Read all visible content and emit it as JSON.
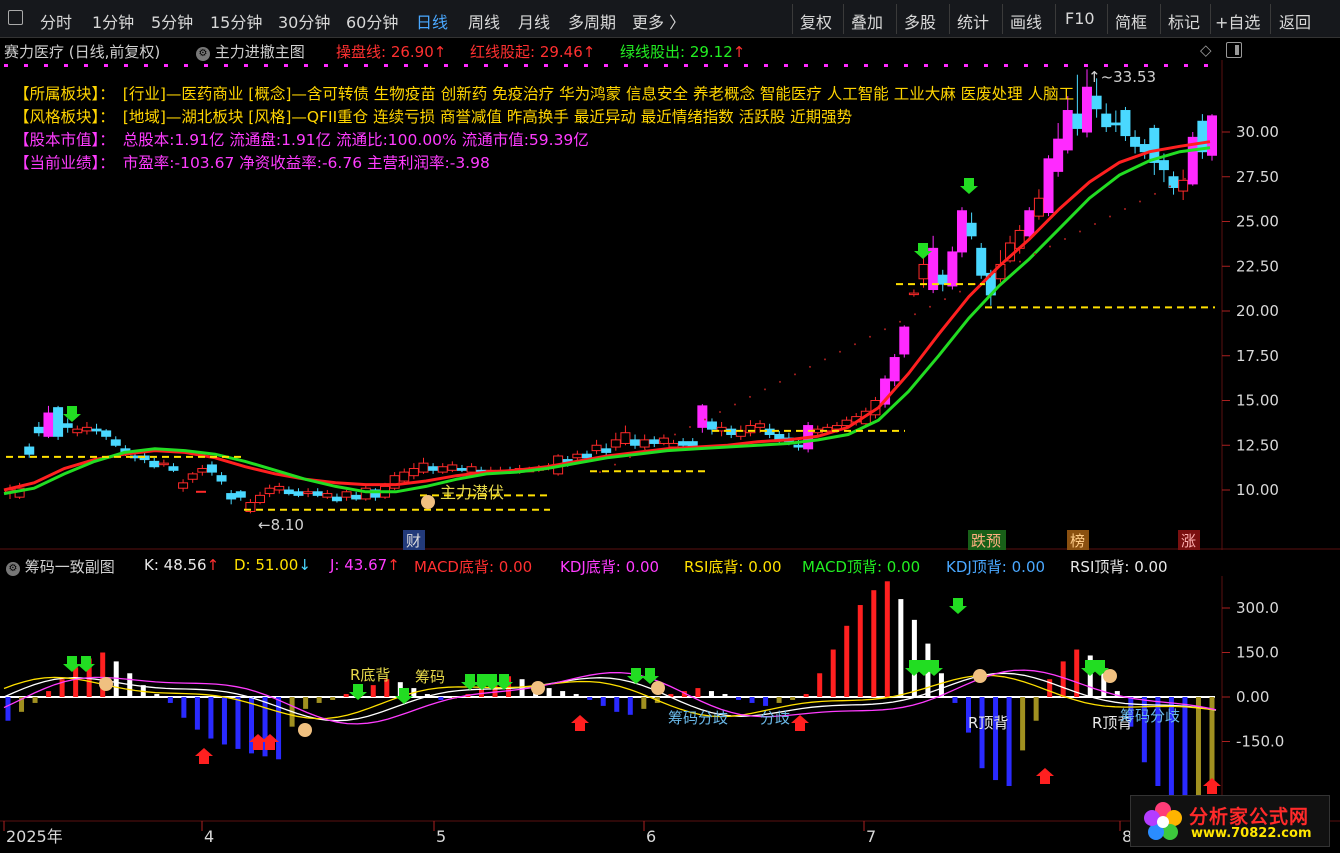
{
  "toolbar": {
    "left": [
      "分时",
      "1分钟",
      "5分钟",
      "15分钟",
      "30分钟",
      "60分钟",
      "日线",
      "周线",
      "月线",
      "多周期",
      "更多 〉"
    ],
    "active": "日线",
    "right": [
      "复权",
      "叠加",
      "多股",
      "统计",
      "画线",
      "F10",
      "简框",
      "标记",
      "+自选",
      "返回"
    ]
  },
  "main_header": {
    "stock": "赛力医疗 (日线,前复权)",
    "indicator": "主力进撤主图",
    "cpx_label": "操盘线: 26.90",
    "red_label": "红线股起: 29.46",
    "green_label": "绿线股出: 29.12",
    "arrow": "↑"
  },
  "info_lines": [
    {
      "tag": "【所属板块】：",
      "text": "[行业]—医药商业 [概念]—含可转债 生物疫苗 创新药 免疫治疗 华为鸿蒙 信息安全 养老概念 智能医疗 人工智能 工业大麻 医废处理 人脑工",
      "tag_color": "#ffd500",
      "text_color": "#ffd500"
    },
    {
      "tag": "【风格板块】：",
      "text": "[地域]—湖北板块 [风格]—QFII重仓 连续亏损 商誉减值 昨高换手 最近异动 最近情绪指数 活跃股 近期强势",
      "tag_color": "#ffd500",
      "text_color": "#ffd500"
    },
    {
      "tag": "【股本市值】：",
      "text": "总股本:1.91亿 流通盘:1.91亿 流通比:100.00% 流通市值:59.39亿",
      "tag_color": "#ff3cff",
      "text_color": "#ff3cff"
    },
    {
      "tag": "【当前业绩】：",
      "text": "市盈率:-103.67 净资收益率:-6.76 主营利润率:-3.98",
      "tag_color": "#ff3cff",
      "text_color": "#ff3cff"
    }
  ],
  "sub_header": {
    "indicator": "筹码一致副图",
    "k": "K: 48.56",
    "d": "D: 51.00",
    "j": "J: 43.67",
    "macd_bot": "MACD底背: 0.00",
    "kdj_bot": "KDJ底背: 0.00",
    "rsi_bot": "RSI底背: 0.00",
    "macd_top": "MACD顶背: 0.00",
    "kdj_top": "KDJ顶背: 0.00",
    "rsi_top": "RSI顶背: 0.00"
  },
  "chart_data": [
    {
      "type": "candlestick",
      "title": "主力进撤主图",
      "ylim": [
        8.0,
        34.5
      ],
      "yticks": [
        "30.00",
        "27.50",
        "25.00",
        "22.50",
        "20.00",
        "17.50",
        "15.00",
        "12.50",
        "10.00"
      ],
      "ytick_values": [
        30.0,
        27.5,
        25.0,
        22.5,
        20.0,
        17.5,
        15.0,
        12.5,
        10.0
      ],
      "x_labels": [
        "2025年",
        "4",
        "5",
        "6",
        "7",
        "8"
      ],
      "series": [
        {
          "name": "红线股起",
          "color": "#ff2020",
          "values": [
            10.0,
            10.4,
            11.2,
            11.7,
            12.0,
            12.2,
            12.1,
            11.8,
            11.3,
            10.9,
            10.6,
            10.4,
            10.3,
            10.3,
            10.5,
            10.8,
            11.0,
            11.1,
            11.3,
            11.6,
            11.9,
            12.1,
            12.3,
            12.4,
            12.5,
            12.7,
            12.8,
            13.0,
            13.5,
            14.6,
            16.5,
            18.7,
            20.8,
            22.5,
            24.0,
            25.7,
            27.2,
            28.3,
            28.9,
            29.2,
            29.46
          ]
        },
        {
          "name": "绿线股出",
          "color": "#22dd22",
          "values": [
            9.8,
            10.1,
            10.9,
            11.6,
            12.1,
            12.3,
            12.2,
            12.0,
            11.6,
            11.1,
            10.6,
            10.2,
            9.9,
            9.9,
            10.2,
            10.6,
            10.9,
            11.0,
            11.2,
            11.5,
            11.8,
            12.0,
            12.2,
            12.3,
            12.4,
            12.5,
            12.6,
            12.8,
            13.1,
            13.9,
            15.5,
            17.5,
            19.6,
            21.4,
            22.9,
            24.6,
            26.3,
            27.6,
            28.4,
            28.9,
            29.12
          ]
        }
      ],
      "candles": [
        {
          "o": 9.9,
          "c": 10.0,
          "h": 10.3,
          "l": 9.5
        },
        {
          "o": 9.6,
          "c": 10.1,
          "h": 10.4,
          "l": 9.5
        },
        {
          "o": 12.4,
          "c": 12.0,
          "h": 12.6,
          "l": 11.8
        },
        {
          "o": 13.5,
          "c": 13.2,
          "h": 13.8,
          "l": 13.0
        },
        {
          "o": 13.0,
          "c": 14.3,
          "h": 14.7,
          "l": 12.9
        },
        {
          "o": 14.6,
          "c": 13.0,
          "h": 14.7,
          "l": 12.8
        },
        {
          "o": 13.7,
          "c": 13.5,
          "h": 14.0,
          "l": 13.2
        },
        {
          "o": 13.2,
          "c": 13.4,
          "h": 13.6,
          "l": 13.0
        },
        {
          "o": 13.3,
          "c": 13.5,
          "h": 13.8,
          "l": 13.1
        },
        {
          "o": 13.4,
          "c": 13.3,
          "h": 13.7,
          "l": 13.1
        },
        {
          "o": 13.3,
          "c": 13.0,
          "h": 13.4,
          "l": 12.8
        },
        {
          "o": 12.8,
          "c": 12.5,
          "h": 13.0,
          "l": 12.4
        },
        {
          "o": 12.3,
          "c": 12.0,
          "h": 12.5,
          "l": 11.9
        },
        {
          "o": 11.9,
          "c": 11.8,
          "h": 12.1,
          "l": 11.6
        },
        {
          "o": 11.9,
          "c": 11.7,
          "h": 12.1,
          "l": 11.5
        },
        {
          "o": 11.6,
          "c": 11.3,
          "h": 11.8,
          "l": 11.2
        },
        {
          "o": 11.5,
          "c": 11.5,
          "h": 11.7,
          "l": 11.3
        },
        {
          "o": 11.3,
          "c": 11.1,
          "h": 11.5,
          "l": 11.0
        },
        {
          "o": 10.1,
          "c": 10.4,
          "h": 10.6,
          "l": 9.9
        },
        {
          "o": 10.6,
          "c": 10.9,
          "h": 11.0,
          "l": 10.4
        },
        {
          "o": 11.0,
          "c": 11.2,
          "h": 11.4,
          "l": 10.8
        },
        {
          "o": 11.4,
          "c": 11.0,
          "h": 11.6,
          "l": 10.8
        },
        {
          "o": 10.8,
          "c": 10.5,
          "h": 11.0,
          "l": 10.3
        },
        {
          "o": 9.8,
          "c": 9.5,
          "h": 10.0,
          "l": 9.2
        },
        {
          "o": 9.9,
          "c": 9.6,
          "h": 10.0,
          "l": 9.4
        },
        {
          "o": 8.8,
          "c": 9.3,
          "h": 9.5,
          "l": 8.7
        },
        {
          "o": 9.3,
          "c": 9.7,
          "h": 9.9,
          "l": 9.2
        },
        {
          "o": 9.8,
          "c": 10.1,
          "h": 10.3,
          "l": 9.6
        },
        {
          "o": 10.0,
          "c": 10.2,
          "h": 10.4,
          "l": 9.8
        },
        {
          "o": 10.0,
          "c": 9.8,
          "h": 10.2,
          "l": 9.7
        },
        {
          "o": 9.9,
          "c": 9.7,
          "h": 10.1,
          "l": 9.6
        },
        {
          "o": 9.8,
          "c": 9.9,
          "h": 10.1,
          "l": 9.6
        },
        {
          "o": 9.9,
          "c": 9.7,
          "h": 10.1,
          "l": 9.6
        },
        {
          "o": 9.6,
          "c": 9.8,
          "h": 10.0,
          "l": 9.5
        },
        {
          "o": 9.6,
          "c": 9.4,
          "h": 9.8,
          "l": 9.3
        },
        {
          "o": 9.6,
          "c": 9.9,
          "h": 10.0,
          "l": 9.4
        },
        {
          "o": 9.7,
          "c": 9.5,
          "h": 9.9,
          "l": 9.4
        },
        {
          "o": 9.5,
          "c": 10.1,
          "h": 10.3,
          "l": 9.4
        },
        {
          "o": 10.0,
          "c": 9.6,
          "h": 10.1,
          "l": 9.4
        },
        {
          "o": 9.6,
          "c": 10.2,
          "h": 10.4,
          "l": 9.5
        },
        {
          "o": 10.1,
          "c": 10.8,
          "h": 11.0,
          "l": 10.0
        },
        {
          "o": 10.5,
          "c": 11.0,
          "h": 11.2,
          "l": 10.4
        },
        {
          "o": 10.8,
          "c": 11.2,
          "h": 11.5,
          "l": 10.6
        },
        {
          "o": 11.0,
          "c": 11.5,
          "h": 11.8,
          "l": 10.9
        },
        {
          "o": 11.3,
          "c": 11.1,
          "h": 11.5,
          "l": 10.9
        },
        {
          "o": 11.0,
          "c": 11.3,
          "h": 11.5,
          "l": 10.9
        },
        {
          "o": 11.1,
          "c": 11.4,
          "h": 11.6,
          "l": 11.0
        },
        {
          "o": 11.2,
          "c": 11.1,
          "h": 11.4,
          "l": 11.0
        },
        {
          "o": 11.0,
          "c": 11.3,
          "h": 11.5,
          "l": 10.9
        },
        {
          "o": 11.1,
          "c": 11.0,
          "h": 11.3,
          "l": 10.9
        },
        {
          "o": 11.0,
          "c": 11.1,
          "h": 11.3,
          "l": 10.9
        },
        {
          "o": 11.0,
          "c": 11.1,
          "h": 11.3,
          "l": 10.9
        },
        {
          "o": 11.1,
          "c": 11.0,
          "h": 11.3,
          "l": 10.9
        },
        {
          "o": 11.0,
          "c": 11.2,
          "h": 11.4,
          "l": 10.9
        },
        {
          "o": 11.1,
          "c": 11.1,
          "h": 11.3,
          "l": 11.0
        },
        {
          "o": 11.1,
          "c": 11.2,
          "h": 11.4,
          "l": 11.0
        },
        {
          "o": 11.2,
          "c": 11.3,
          "h": 11.5,
          "l": 11.1
        },
        {
          "o": 10.9,
          "c": 11.9,
          "h": 12.0,
          "l": 10.8
        },
        {
          "o": 11.7,
          "c": 11.5,
          "h": 11.9,
          "l": 11.3
        },
        {
          "o": 11.8,
          "c": 12.0,
          "h": 12.2,
          "l": 11.6
        },
        {
          "o": 12.0,
          "c": 11.8,
          "h": 12.2,
          "l": 11.6
        },
        {
          "o": 12.2,
          "c": 12.5,
          "h": 12.8,
          "l": 12.0
        },
        {
          "o": 12.3,
          "c": 12.1,
          "h": 12.6,
          "l": 11.9
        },
        {
          "o": 12.4,
          "c": 12.8,
          "h": 13.2,
          "l": 12.2
        },
        {
          "o": 12.6,
          "c": 13.2,
          "h": 13.6,
          "l": 12.5
        },
        {
          "o": 12.8,
          "c": 12.5,
          "h": 13.1,
          "l": 12.3
        },
        {
          "o": 12.4,
          "c": 12.8,
          "h": 13.1,
          "l": 12.2
        },
        {
          "o": 12.8,
          "c": 12.6,
          "h": 13.0,
          "l": 12.4
        },
        {
          "o": 12.6,
          "c": 12.9,
          "h": 13.1,
          "l": 12.5
        },
        {
          "o": 12.4,
          "c": 12.6,
          "h": 12.8,
          "l": 12.2
        },
        {
          "o": 12.7,
          "c": 12.5,
          "h": 12.9,
          "l": 12.3
        },
        {
          "o": 12.7,
          "c": 12.4,
          "h": 12.9,
          "l": 12.3
        },
        {
          "o": 13.5,
          "c": 14.7,
          "h": 14.8,
          "l": 13.2
        },
        {
          "o": 13.8,
          "c": 13.4,
          "h": 14.0,
          "l": 13.1
        },
        {
          "o": 13.3,
          "c": 13.5,
          "h": 13.8,
          "l": 13.0
        },
        {
          "o": 13.4,
          "c": 13.1,
          "h": 13.6,
          "l": 12.9
        },
        {
          "o": 13.0,
          "c": 13.3,
          "h": 13.6,
          "l": 12.8
        },
        {
          "o": 13.2,
          "c": 13.6,
          "h": 13.9,
          "l": 13.0
        },
        {
          "o": 13.5,
          "c": 13.7,
          "h": 13.9,
          "l": 13.2
        },
        {
          "o": 13.4,
          "c": 13.1,
          "h": 13.7,
          "l": 12.9
        },
        {
          "o": 13.1,
          "c": 12.8,
          "h": 13.3,
          "l": 12.6
        },
        {
          "o": 12.9,
          "c": 12.7,
          "h": 13.2,
          "l": 12.5
        },
        {
          "o": 12.5,
          "c": 12.4,
          "h": 12.8,
          "l": 12.2
        },
        {
          "o": 12.3,
          "c": 13.6,
          "h": 13.8,
          "l": 12.1
        },
        {
          "o": 13.2,
          "c": 13.4,
          "h": 13.6,
          "l": 13.0
        },
        {
          "o": 13.3,
          "c": 13.5,
          "h": 13.7,
          "l": 13.1
        },
        {
          "o": 13.4,
          "c": 13.6,
          "h": 13.8,
          "l": 13.2
        },
        {
          "o": 13.6,
          "c": 13.9,
          "h": 14.1,
          "l": 13.4
        },
        {
          "o": 13.8,
          "c": 14.1,
          "h": 14.3,
          "l": 13.6
        },
        {
          "o": 13.7,
          "c": 14.4,
          "h": 14.6,
          "l": 13.5
        },
        {
          "o": 14.2,
          "c": 15.0,
          "h": 15.2,
          "l": 14.0
        },
        {
          "o": 14.8,
          "c": 16.2,
          "h": 16.4,
          "l": 14.6
        },
        {
          "o": 16.1,
          "c": 17.4,
          "h": 17.6,
          "l": 15.8
        },
        {
          "o": 17.6,
          "c": 19.1,
          "h": 19.2,
          "l": 17.4
        },
        {
          "o": 21.0,
          "c": 21.0,
          "h": 21.2,
          "l": 20.8
        },
        {
          "o": 21.8,
          "c": 22.6,
          "h": 23.1,
          "l": 21.3
        },
        {
          "o": 21.2,
          "c": 23.5,
          "h": 24.2,
          "l": 21.0
        },
        {
          "o": 22.0,
          "c": 21.5,
          "h": 22.3,
          "l": 21.1
        },
        {
          "o": 21.4,
          "c": 23.3,
          "h": 23.6,
          "l": 21.2
        },
        {
          "o": 23.3,
          "c": 25.6,
          "h": 25.8,
          "l": 23.0
        },
        {
          "o": 24.9,
          "c": 24.2,
          "h": 25.5,
          "l": 24.0
        },
        {
          "o": 23.5,
          "c": 22.0,
          "h": 23.8,
          "l": 21.8
        },
        {
          "o": 22.1,
          "c": 20.9,
          "h": 22.3,
          "l": 20.3
        },
        {
          "o": 21.8,
          "c": 22.6,
          "h": 23.4,
          "l": 21.6
        },
        {
          "o": 22.8,
          "c": 23.8,
          "h": 24.2,
          "l": 22.7
        },
        {
          "o": 23.5,
          "c": 24.5,
          "h": 24.8,
          "l": 23.2
        },
        {
          "o": 24.2,
          "c": 25.6,
          "h": 25.8,
          "l": 24.0
        },
        {
          "o": 25.3,
          "c": 26.3,
          "h": 26.8,
          "l": 25.1
        },
        {
          "o": 25.5,
          "c": 28.5,
          "h": 28.7,
          "l": 25.3
        },
        {
          "o": 27.8,
          "c": 29.6,
          "h": 30.5,
          "l": 27.5
        },
        {
          "o": 29.0,
          "c": 31.2,
          "h": 32.0,
          "l": 28.8
        },
        {
          "o": 31.0,
          "c": 30.2,
          "h": 33.2,
          "l": 29.8
        },
        {
          "o": 30.0,
          "c": 32.5,
          "h": 33.5,
          "l": 29.7
        },
        {
          "o": 32.0,
          "c": 31.3,
          "h": 33.0,
          "l": 30.8
        },
        {
          "o": 31.0,
          "c": 30.3,
          "h": 31.6,
          "l": 30.0
        },
        {
          "o": 30.5,
          "c": 30.4,
          "h": 31.2,
          "l": 30.0
        },
        {
          "o": 31.2,
          "c": 29.8,
          "h": 31.4,
          "l": 29.5
        },
        {
          "o": 29.7,
          "c": 29.2,
          "h": 30.1,
          "l": 28.8
        },
        {
          "o": 29.3,
          "c": 28.9,
          "h": 29.6,
          "l": 28.5
        },
        {
          "o": 30.2,
          "c": 28.3,
          "h": 30.4,
          "l": 27.6
        },
        {
          "o": 28.4,
          "c": 27.9,
          "h": 28.8,
          "l": 27.2
        },
        {
          "o": 27.5,
          "c": 26.9,
          "h": 27.8,
          "l": 26.5
        },
        {
          "o": 26.7,
          "c": 27.3,
          "h": 27.9,
          "l": 26.2
        },
        {
          "o": 27.1,
          "c": 29.7,
          "h": 30.0,
          "l": 27.0
        },
        {
          "o": 30.6,
          "c": 28.9,
          "h": 31.0,
          "l": 28.5
        },
        {
          "o": 28.7,
          "c": 30.9,
          "h": 31.0,
          "l": 28.4
        }
      ],
      "annotations": [
        "↑~33.53",
        "←8.10",
        "主力潜伏",
        "财",
        "跌预",
        "榜",
        "涨"
      ]
    },
    {
      "type": "bar",
      "title": "筹码一致副图",
      "ylim": [
        -450,
        450
      ],
      "yticks": [
        "300.0",
        "150.0",
        "0.00",
        "-150.0"
      ],
      "ytick_values": [
        300,
        150,
        0,
        -150
      ],
      "series": [
        {
          "name": "MACD",
          "values": [
            -80,
            -50,
            -20,
            20,
            60,
            100,
            130,
            150,
            120,
            80,
            40,
            10,
            -20,
            -70,
            -110,
            -140,
            -160,
            -175,
            -190,
            -200,
            -210,
            -100,
            -40,
            -20,
            -10,
            10,
            30,
            40,
            60,
            50,
            30,
            10,
            -10,
            -5,
            10,
            30,
            50,
            70,
            60,
            40,
            30,
            20,
            10,
            -10,
            -30,
            -50,
            -60,
            -40,
            -20,
            10,
            20,
            30,
            20,
            10,
            -10,
            -20,
            -30,
            -20,
            -10,
            10,
            80,
            160,
            240,
            310,
            360,
            390,
            330,
            260,
            180,
            80,
            -20,
            -120,
            -240,
            -280,
            -300,
            -180,
            -80,
            60,
            120,
            160,
            140,
            80,
            20,
            -100,
            -220,
            -300,
            -350,
            -380,
            -360,
            -300
          ]
        }
      ],
      "annotations": [
        "R底背",
        "筹码",
        "筹码分歧",
        "分歧",
        "R顶背",
        "R顶背",
        "筹码分歧"
      ]
    }
  ],
  "watermark": {
    "title": "分析家公式网",
    "url": "www.70822.com"
  },
  "colors": {
    "up": "#ff2a2a",
    "down": "#4ad8ff",
    "doji": "#ff2aff",
    "red_line": "#ff2020",
    "green_line": "#22dd22",
    "support": "#ffe000"
  }
}
